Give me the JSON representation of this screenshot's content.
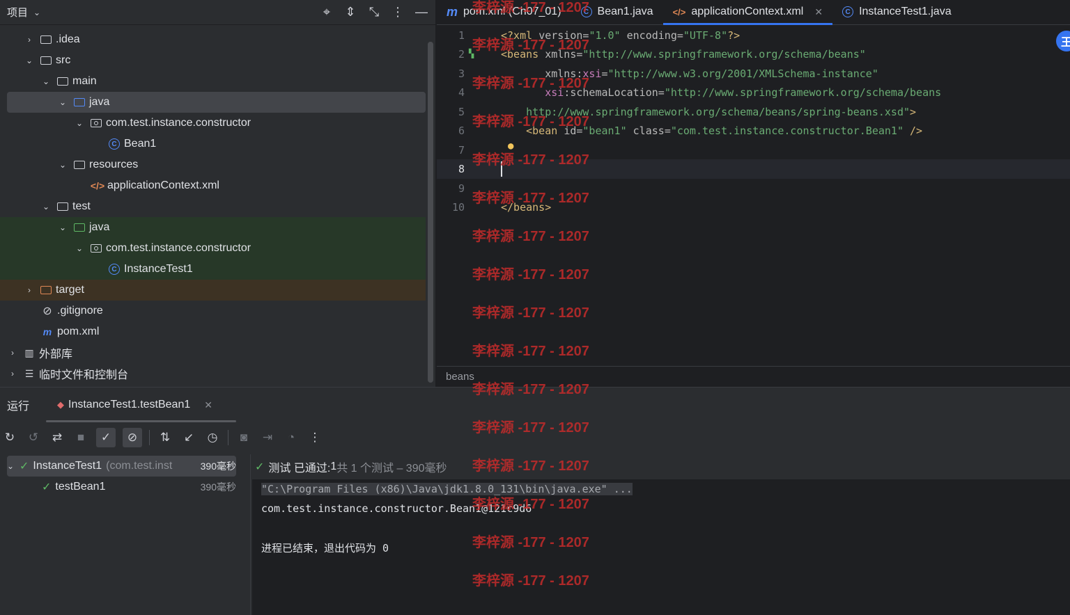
{
  "project": {
    "title": "项目",
    "tools": [
      "locate-icon",
      "expand-icon",
      "collapse-icon",
      "more-icon",
      "minimize-icon"
    ],
    "items": [
      {
        "label": ".idea"
      },
      {
        "label": "src"
      },
      {
        "label": "main"
      },
      {
        "label": "java"
      },
      {
        "label": "com.test.instance.constructor"
      },
      {
        "label": "Bean1"
      },
      {
        "label": "resources"
      },
      {
        "label": "applicationContext.xml"
      },
      {
        "label": "test"
      },
      {
        "label": "java"
      },
      {
        "label": "com.test.instance.constructor"
      },
      {
        "label": "InstanceTest1"
      },
      {
        "label": "target"
      },
      {
        "label": ".gitignore"
      },
      {
        "label": "pom.xml"
      },
      {
        "label": "外部库"
      },
      {
        "label": "临时文件和控制台"
      }
    ]
  },
  "editor": {
    "tabs": [
      {
        "label": "pom.xml (Ch07_01)"
      },
      {
        "label": "Bean1.java"
      },
      {
        "label": "applicationContext.xml"
      },
      {
        "label": "InstanceTest1.java"
      }
    ],
    "line_numbers": [
      "1",
      "2",
      "3",
      "4",
      "5",
      "6",
      "7",
      "8",
      "9",
      "10"
    ],
    "lines": [
      {
        "p1": "<?xml ",
        "p2": "version",
        "p3": "=",
        "p4": "\"1.0\"",
        "p5": " encoding",
        "p6": "=",
        "p7": "\"UTF-8\"",
        "p8": "?>"
      },
      {
        "p1": "<beans ",
        "p2": "xmlns",
        "p3": "=",
        "p4": "\"http://www.springframework.org/schema/beans\""
      },
      {
        "p1": "       xmlns:",
        "p2": "xsi",
        "p3": "=",
        "p4": "\"http://www.w3.org/2001/XMLSchema-instance\""
      },
      {
        "p1": "       ",
        "p2": "xsi",
        "p3": ":schemaLocation=",
        "p4": "\"http://www.springframework.org/schema/beans"
      },
      {
        "p1": "    ",
        "p2": "http://www.springframework.org/schema/beans/spring-beans.xsd\"",
        "p3": ">"
      },
      {
        "p1": "    <bean ",
        "p2": "id",
        "p3": "=",
        "p4": "\"bean1\"",
        "p5": " class",
        "p6": "=",
        "p7": "\"com.test.instance.constructor.Bean1\"",
        "p8": " />"
      },
      {
        "p1": ""
      },
      {
        "p1": ""
      },
      {
        "p1": ""
      },
      {
        "p1": "</beans>"
      }
    ],
    "breadcrumb": "beans"
  },
  "run": {
    "title": "运行",
    "tab_label": "InstanceTest1.testBean1",
    "tree": [
      {
        "name": "InstanceTest1",
        "detail": "(com.test.inst",
        "time": "390毫秒"
      },
      {
        "name": "testBean1",
        "time": "390毫秒"
      }
    ],
    "status_prefix": "测试 已通过: ",
    "status_count": "1",
    "status_rest": "共 1 个测试 – 390毫秒",
    "console": [
      "\"C:\\Program Files (x86)\\Java\\jdk1.8.0_131\\bin\\java.exe\" ...",
      "com.test.instance.constructor.Bean1@121c9d6",
      "",
      "进程已结束，退出代码为 0"
    ]
  },
  "watermark": "李梓源 -177 - 1207",
  "avatar_text": "王"
}
